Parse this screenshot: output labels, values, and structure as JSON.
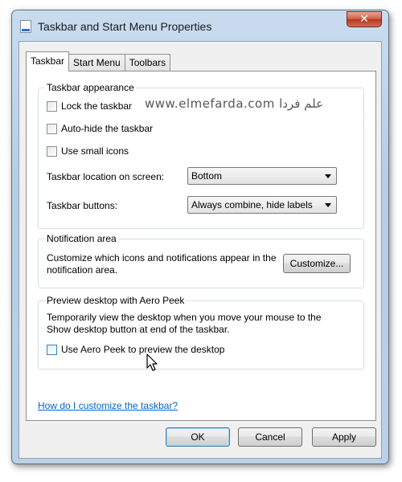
{
  "window": {
    "title": "Taskbar and Start Menu Properties",
    "close_glyph": "✕"
  },
  "tabs": [
    {
      "label": "Taskbar",
      "active": true
    },
    {
      "label": "Start Menu",
      "active": false
    },
    {
      "label": "Toolbars",
      "active": false
    }
  ],
  "appearance": {
    "title": "Taskbar appearance",
    "lock_label": "Lock the taskbar",
    "lock_checked": false,
    "autohide_label": "Auto-hide the taskbar",
    "autohide_checked": false,
    "small_icons_label": "Use small icons",
    "small_icons_checked": false,
    "location_label": "Taskbar location on screen:",
    "location_value": "Bottom",
    "buttons_label": "Taskbar buttons:",
    "buttons_value": "Always combine, hide labels"
  },
  "notification": {
    "title": "Notification area",
    "description_line1": "Customize which icons and notifications appear in the",
    "description_line2": "notification area.",
    "customize_button": "Customize..."
  },
  "aero_peek": {
    "title": "Preview desktop with Aero Peek",
    "description_line1": "Temporarily view the desktop when you move your mouse to the",
    "description_line2": "Show desktop button at end of the taskbar.",
    "checkbox_label": "Use Aero Peek to preview the desktop",
    "checkbox_checked": false
  },
  "help_link": "How do I customize the taskbar?",
  "footer": {
    "ok": "OK",
    "cancel": "Cancel",
    "apply": "Apply"
  },
  "watermark": "www.elmefarda.com علم فردا",
  "icons": {
    "app": "taskbar-properties-icon",
    "close": "close-icon",
    "dropdown": "chevron-down-icon",
    "cursor": "mouse-pointer-icon"
  },
  "colors": {
    "link": "#0066cc",
    "close_button": "#c9452c",
    "title_bar": "#bcd1e7"
  }
}
